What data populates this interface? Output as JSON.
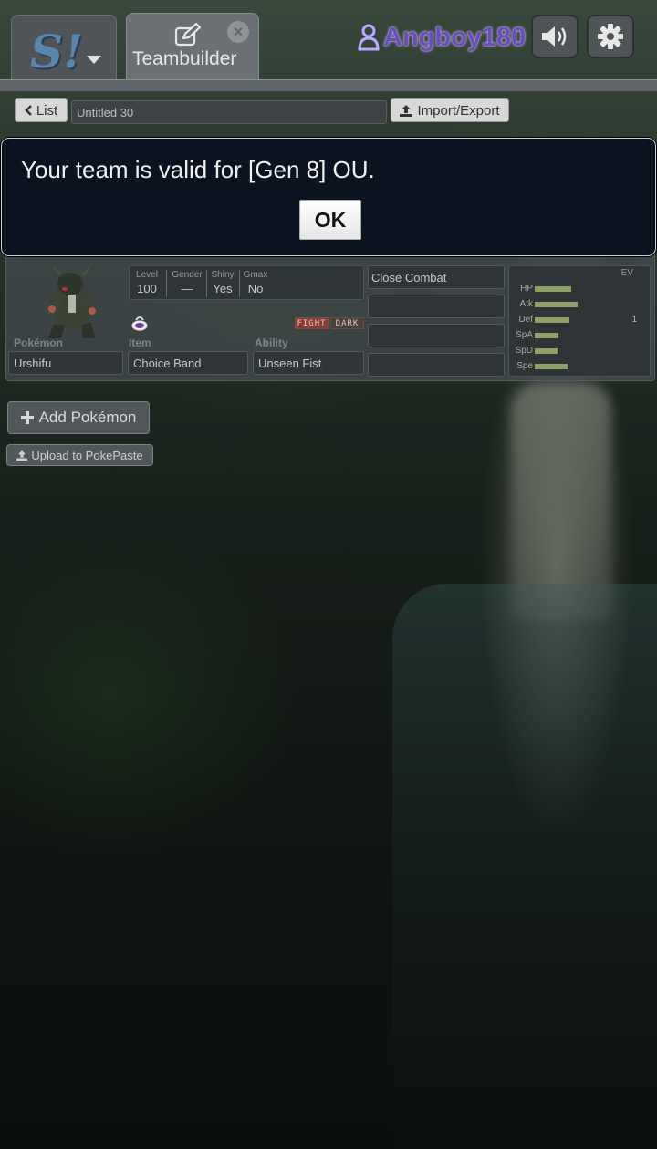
{
  "header": {
    "logo_text": "S!",
    "active_tab_label": "Teambuilder",
    "username": "Angboy180",
    "icons": [
      "dropdown-caret-icon",
      "edit-icon",
      "close-icon",
      "user-icon",
      "volume-icon",
      "gear-icon"
    ]
  },
  "toolbar": {
    "list_label": "List",
    "team_name": "Untitled 30",
    "import_export_label": "Import/Export"
  },
  "dialog": {
    "message": "Your team is valid for [Gen 8] OU.",
    "ok_label": "OK"
  },
  "pokemon": {
    "details": {
      "level_label": "Level",
      "level": "100",
      "gender_label": "Gender",
      "gender": "—",
      "shiny_label": "Shiny",
      "shiny": "Yes",
      "gmax_label": "Gmax",
      "gmax": "No"
    },
    "types": [
      "FIGHT",
      "DARK"
    ],
    "pokemon_label": "Pokémon",
    "name": "Urshifu",
    "item_label": "Item",
    "item": "Choice Band",
    "ability_label": "Ability",
    "ability": "Unseen Fist",
    "moves": [
      "Close Combat",
      "",
      "",
      ""
    ],
    "stats": {
      "ev_label": "EV",
      "rows": [
        {
          "label": "HP",
          "ev": "",
          "fill": 0.44
        },
        {
          "label": "Atk",
          "ev": "",
          "fill": 0.52
        },
        {
          "label": "Def",
          "ev": "1",
          "fill": 0.42
        },
        {
          "label": "SpA",
          "ev": "",
          "fill": 0.29
        },
        {
          "label": "SpD",
          "ev": "",
          "fill": 0.28
        },
        {
          "label": "Spe",
          "ev": "",
          "fill": 0.4
        }
      ]
    }
  },
  "actions": {
    "add_pokemon_label": "Add Pokémon",
    "upload_label": "Upload to PokePaste"
  }
}
